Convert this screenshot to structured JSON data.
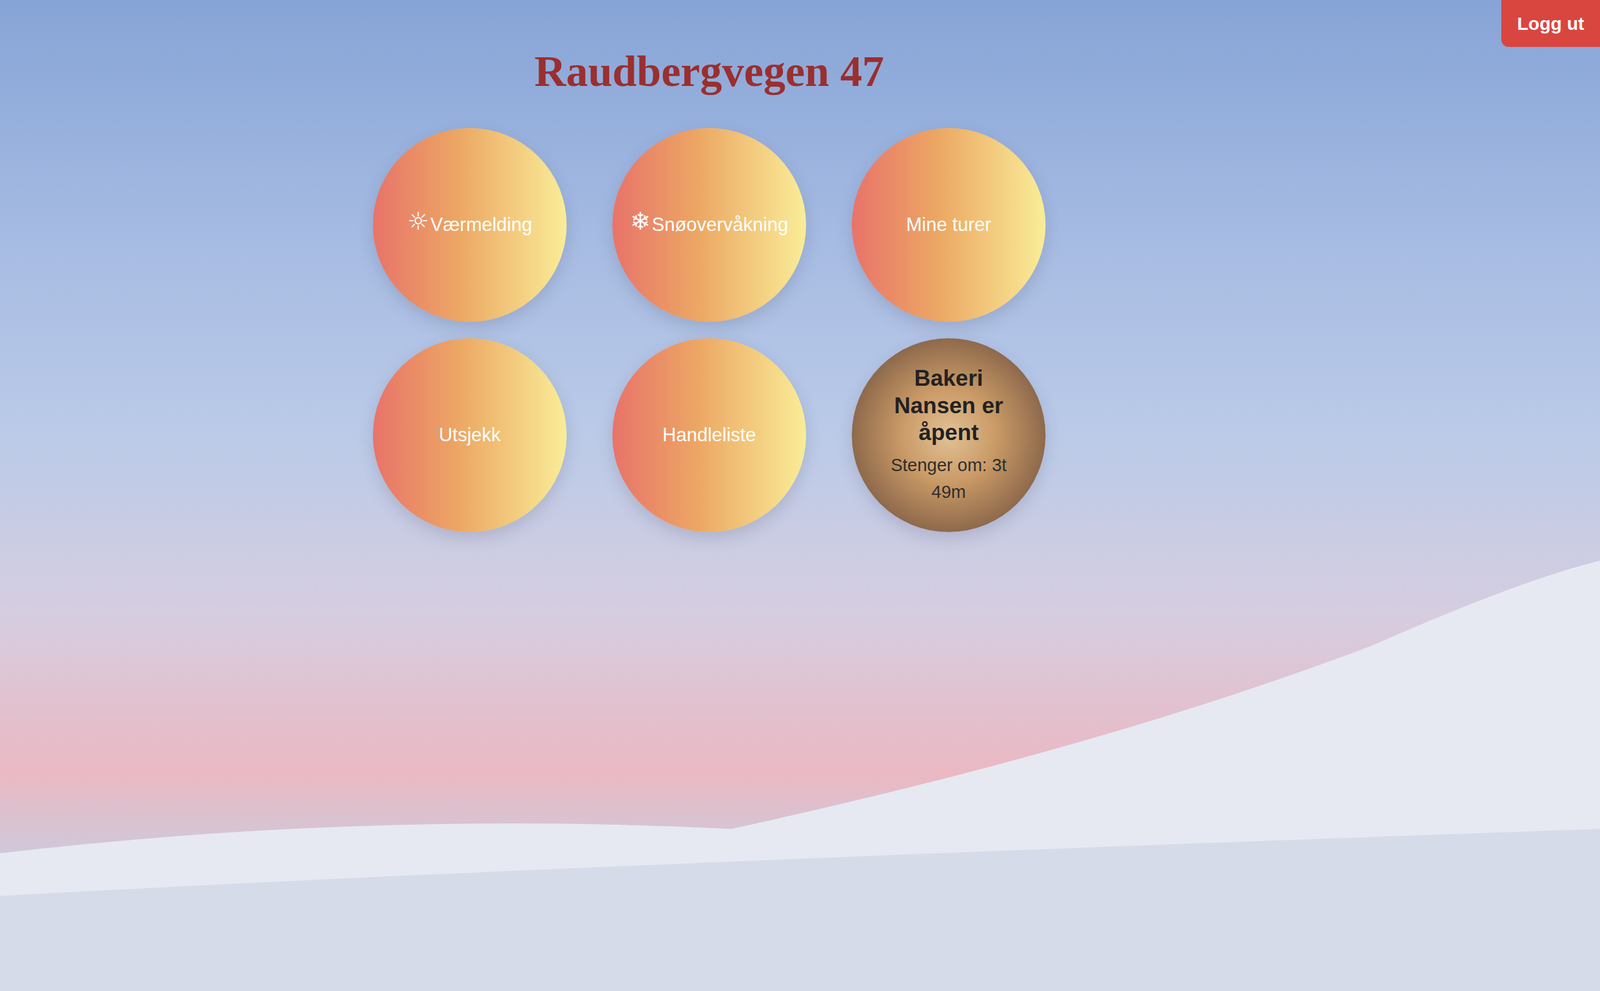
{
  "header": {
    "title": "Raudbergvegen 47"
  },
  "logout_button": {
    "label": "Logg ut"
  },
  "tiles": [
    {
      "kind": "menu",
      "icon": "☼",
      "label": "Værmelding"
    },
    {
      "kind": "menu",
      "icon": "❄",
      "label": "Snøovervåkning"
    },
    {
      "kind": "menu",
      "icon": "",
      "label": "Mine turer"
    },
    {
      "kind": "menu",
      "icon": "",
      "label": "Utsjekk"
    },
    {
      "kind": "menu",
      "icon": "",
      "label": "Handleliste"
    },
    {
      "kind": "status",
      "title": "Bakeri Nansen er åpent",
      "subtitle": "Stenger om: 3t 49m"
    }
  ]
}
